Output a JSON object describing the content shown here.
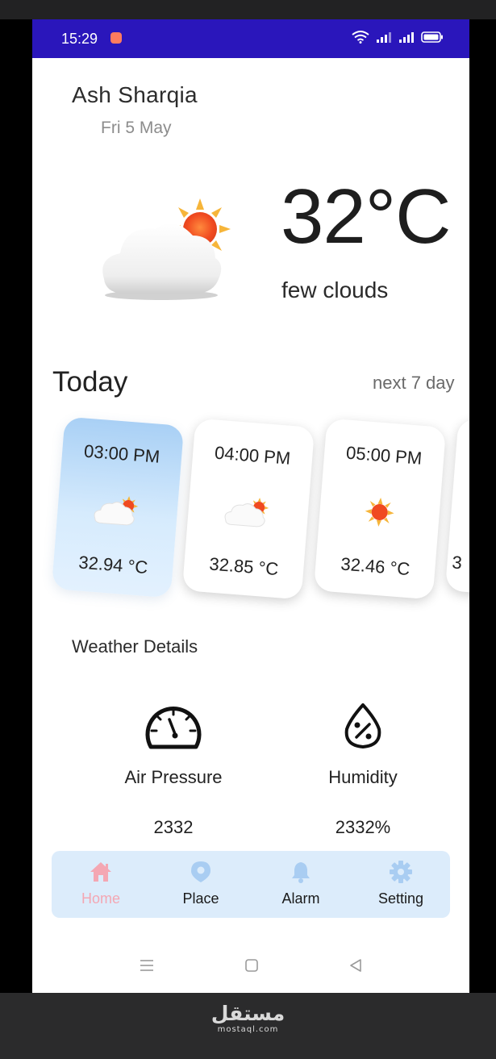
{
  "status_bar": {
    "time": "15:29"
  },
  "location": {
    "city": "Ash Sharqia",
    "date": "Fri 5 May"
  },
  "current": {
    "temperature": "32°C",
    "condition": "few clouds"
  },
  "hourly_header": {
    "title": "Today",
    "link": "next 7 day"
  },
  "hourly": [
    {
      "time": "03:00 PM",
      "temp": "32.94 °C",
      "icon": "cloud-sun-icon"
    },
    {
      "time": "04:00 PM",
      "temp": "32.85 °C",
      "icon": "cloud-sun-icon"
    },
    {
      "time": "05:00 PM",
      "temp": "32.46 °C",
      "icon": "sun-icon"
    },
    {
      "time": "",
      "temp": "3",
      "icon": ""
    }
  ],
  "details": {
    "title": "Weather Details",
    "air_pressure": {
      "label": "Air Pressure",
      "value": "2332",
      "icon": "gauge-icon"
    },
    "humidity": {
      "label": "Humidity",
      "value": "2332%",
      "icon": "humidity-drop-icon"
    }
  },
  "nav": {
    "items": [
      {
        "label": "Home",
        "icon": "home-icon"
      },
      {
        "label": "Place",
        "icon": "location-pin-icon"
      },
      {
        "label": "Alarm",
        "icon": "bell-icon"
      },
      {
        "label": "Setting",
        "icon": "gear-icon"
      }
    ],
    "active_color": "#f4a7b3",
    "icon_color": "#a9cdf2"
  },
  "watermark": {
    "arabic": "مستقل",
    "latin": "mostaql.com"
  },
  "colors": {
    "status_bar": "#2a16bb",
    "nav_background": "#dcecfb",
    "active_card": "#c2e0fb"
  }
}
